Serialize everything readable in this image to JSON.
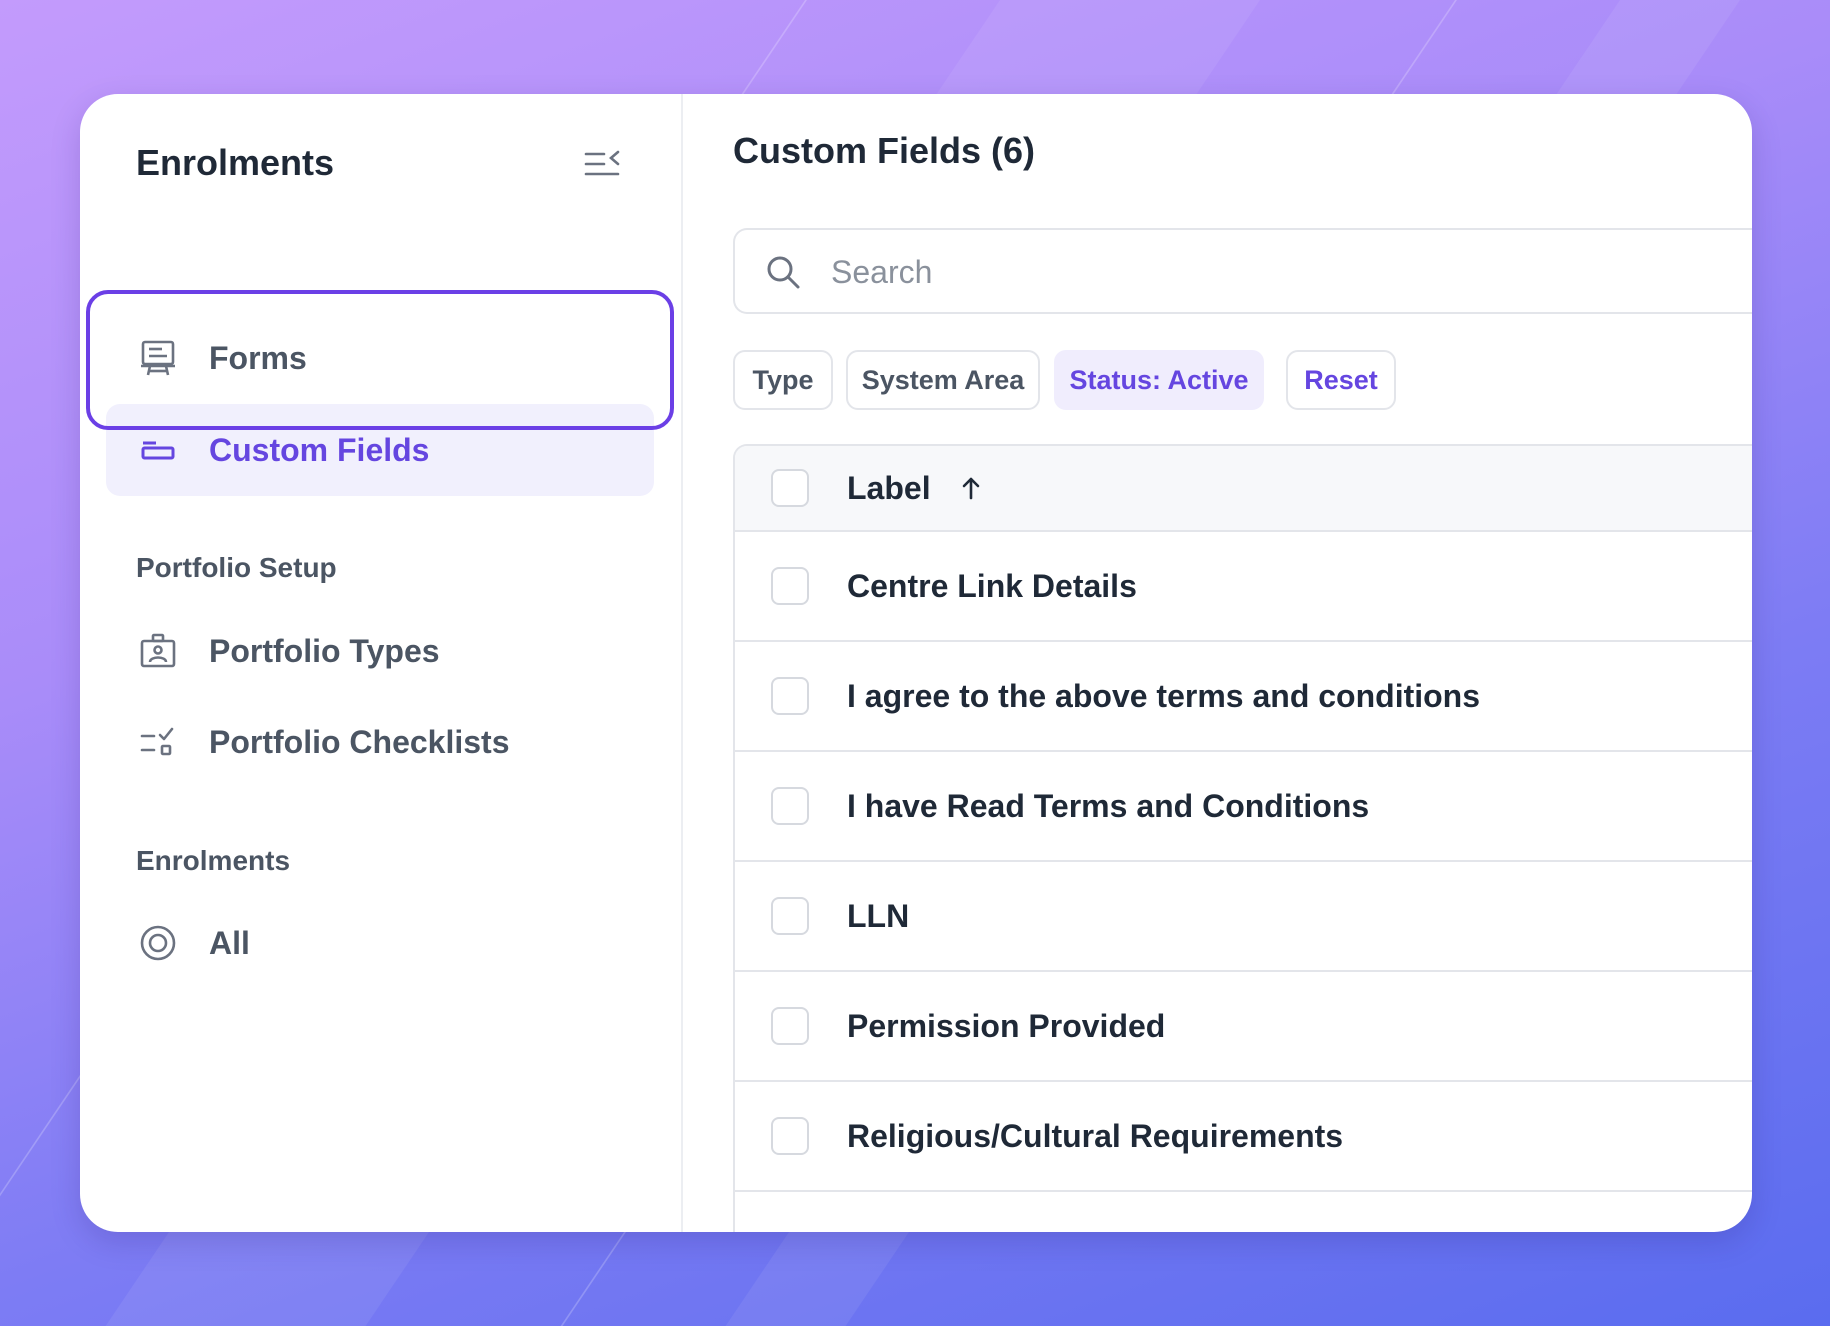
{
  "sidebar": {
    "title": "Enrolments",
    "items": [
      {
        "label": "Forms",
        "icon": "forms-icon"
      },
      {
        "label": "Custom Fields",
        "icon": "custom-fields-icon",
        "active": true
      }
    ],
    "portfolio_heading": "Portfolio Setup",
    "portfolio_items": [
      {
        "label": "Portfolio Types",
        "icon": "portfolio-types-icon"
      },
      {
        "label": "Portfolio Checklists",
        "icon": "portfolio-checklists-icon"
      }
    ],
    "enrolments_heading": "Enrolments",
    "enrolments_items": [
      {
        "label": "All",
        "icon": "target-icon"
      }
    ]
  },
  "main": {
    "title": "Custom Fields (6)",
    "search": {
      "placeholder": "Search",
      "value": ""
    },
    "filters": {
      "type": "Type",
      "system_area": "System Area",
      "status": "Status: Active",
      "reset": "Reset"
    },
    "table": {
      "header": "Label",
      "rows": [
        "Centre Link Details",
        "I agree to the above terms and conditions",
        "I have Read Terms and Conditions",
        "LLN",
        "Permission Provided",
        "Religious/Cultural Requirements"
      ]
    }
  },
  "colors": {
    "accent": "#6546e0",
    "active_bg": "#f1f0fd",
    "highlight_ring": "#6b3fe6",
    "text_dark": "#1f2937",
    "text_muted": "#4b5563"
  }
}
